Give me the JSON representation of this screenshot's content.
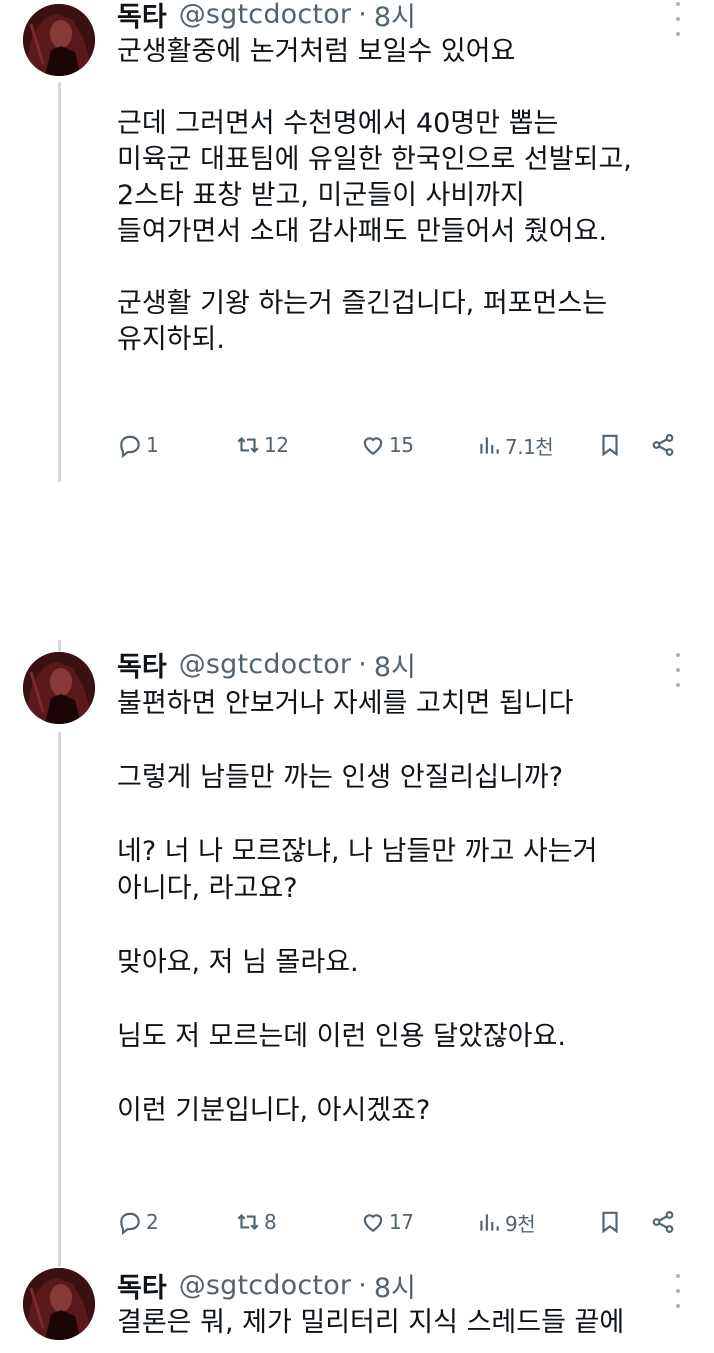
{
  "tweets": [
    {
      "name": "독타",
      "handle": "@sgtcdoctor",
      "separator": "·",
      "time": "8시",
      "text": "군생활중에 논거처럼 보일수 있어요\n\n근데 그러면서 수천명에서 40명만 뽑는\n미육군 대표팀에 유일한 한국인으로 선발되고,\n2스타 표창 받고, 미군들이 사비까지\n들여가면서 소대 감사패도 만들어서 줬어요.\n\n군생활 기왕 하는거 즐긴겁니다, 퍼포먼스는\n유지하되.",
      "replies": "1",
      "retweets": "12",
      "likes": "15",
      "views": "7.1천"
    },
    {
      "name": "독타",
      "handle": "@sgtcdoctor",
      "separator": "·",
      "time": "8시",
      "text": "불편하면 안보거나 자세를 고치면 됩니다\n\n그렇게 남들만 까는 인생 안질리십니까?\n\n네? 너 나 모르잖냐, 나 남들만 까고 사는거\n아니다, 라고요?\n\n맞아요, 저 님 몰라요.\n\n님도 저 모르는데 이런 인용 달았잖아요.\n\n이런 기분입니다, 아시겠죠?",
      "replies": "2",
      "retweets": "8",
      "likes": "17",
      "views": "9천"
    },
    {
      "name": "독타",
      "handle": "@sgtcdoctor",
      "separator": "·",
      "time": "8시",
      "text": "결론은 뭐, 제가 밀리터리 지식 스레드들 끝에"
    }
  ],
  "icons": {
    "reply": "reply-icon",
    "retweet": "retweet-icon",
    "like": "heart-icon",
    "views": "views-chart-icon",
    "bookmark": "bookmark-icon",
    "share": "share-icon",
    "more": "more-dots-icon"
  },
  "colors": {
    "text": "#0f1419",
    "secondary": "#536471",
    "thread_line": "#cfd9de"
  }
}
